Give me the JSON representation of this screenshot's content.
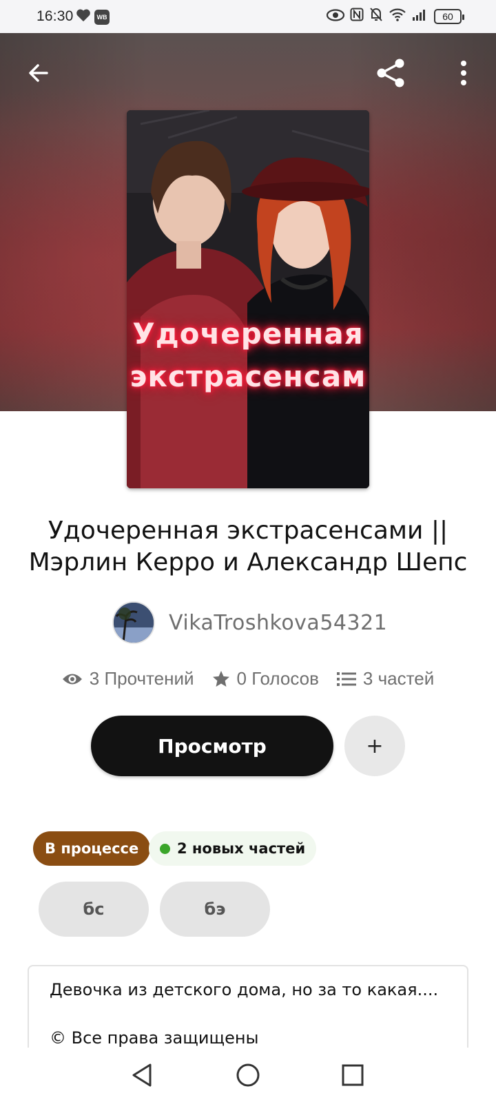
{
  "status_bar": {
    "time": "16:30",
    "wb_badge": "WB",
    "battery": "60",
    "icons": [
      "heart-icon",
      "wb-app-icon",
      "eye-icon",
      "nfc-icon",
      "mute-icon",
      "wifi-icon",
      "signal-icon",
      "battery-icon"
    ]
  },
  "header": {
    "icons": [
      "back-arrow-icon",
      "share-icon",
      "more-vertical-icon"
    ]
  },
  "cover": {
    "line1": "Удочеренная",
    "line2": "экстрасенсам"
  },
  "story": {
    "title": "Удочеренная экстрасенсами || Мэрлин Керро и Александр Шепс",
    "author": "VikaTroshkova54321"
  },
  "stats": {
    "reads": "3 Прочтений",
    "votes": "0 Голосов",
    "parts": "3 частей"
  },
  "actions": {
    "read_label": "Просмотр",
    "add_label": "+"
  },
  "badges": {
    "status": "В процессе",
    "new_parts": "2 новых частей"
  },
  "tags": [
    "бс",
    "бэ"
  ],
  "description": {
    "line1": "Девочка из детского дома, но за то какая....",
    "line2": "© Все права защищены"
  },
  "colors": {
    "primary_button": "#121212",
    "status_badge": "#8a4d12",
    "new_dot": "#3aa52a",
    "tag_bg": "#e4e4e4"
  }
}
